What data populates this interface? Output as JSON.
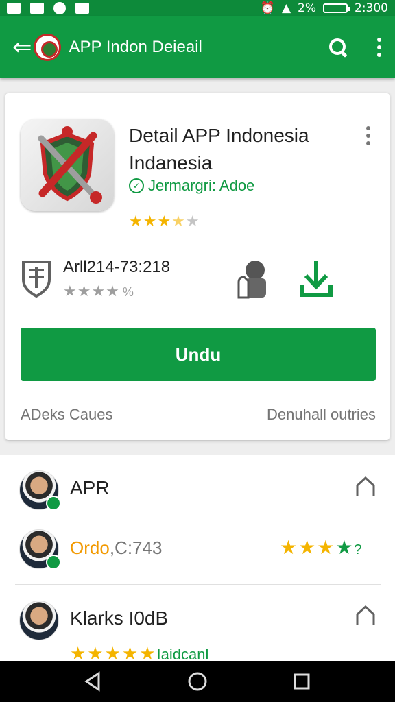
{
  "status_bar": {
    "battery_text": "2%",
    "time": "2:300",
    "background": "#0d8a3a"
  },
  "app_bar": {
    "title": "APP Indon  Deieail",
    "background": "#109a43"
  },
  "app_card": {
    "title": "Detail APP Indonesia Indanesia",
    "developer": "Jermargri: Adoe",
    "rating_stars": 3.5,
    "meta_text": "Arll214-73:218",
    "meta_rating_suffix": "%",
    "install_label": "Undu",
    "footer_left": "ADeks Caues",
    "footer_right": "Denuhall outries"
  },
  "list_items": [
    {
      "title": "APR"
    },
    {
      "subtitle_accent": "Ordo",
      "subtitle_rest": ",C:743",
      "rating": 4.5
    },
    {
      "title": "Klarks I0dB",
      "subtitle": "Iaidcanl"
    }
  ],
  "colors": {
    "accent": "#109a43",
    "star": "#f4b400",
    "orange": "#f29900"
  }
}
